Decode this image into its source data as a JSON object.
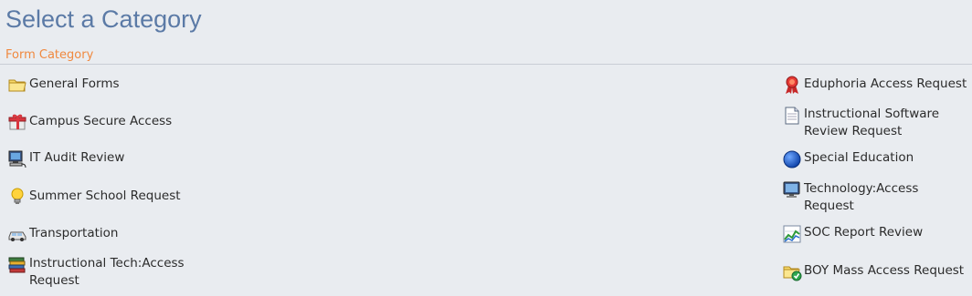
{
  "page": {
    "title": "Select a Category",
    "subtitle": "Form Category"
  },
  "categories_left": [
    {
      "label": "General Forms",
      "icon": "folder-icon"
    },
    {
      "label": "Campus Secure Access",
      "icon": "gift-box-icon"
    },
    {
      "label": "IT Audit Review",
      "icon": "computer-icon"
    },
    {
      "label": "Summer School Request",
      "icon": "lightbulb-icon"
    },
    {
      "label": "Transportation",
      "icon": "car-icon"
    },
    {
      "label": "Instructional Tech:Access Request",
      "icon": "books-icon"
    }
  ],
  "categories_right": [
    {
      "label": "Eduphoria Access Request",
      "icon": "award-ribbon-icon"
    },
    {
      "label": "Instructional Software Review Request",
      "icon": "document-icon"
    },
    {
      "label": "Special Education",
      "icon": "blue-globe-icon"
    },
    {
      "label": "Technology:Access Request",
      "icon": "computer-icon"
    },
    {
      "label": "SOC Report Review",
      "icon": "chart-icon"
    },
    {
      "label": "BOY Mass Access Request",
      "icon": "folder-check-icon"
    }
  ],
  "colors": {
    "title": "#5b7aa6",
    "subtitle": "#f0883e",
    "background": "#e9ecf0"
  }
}
